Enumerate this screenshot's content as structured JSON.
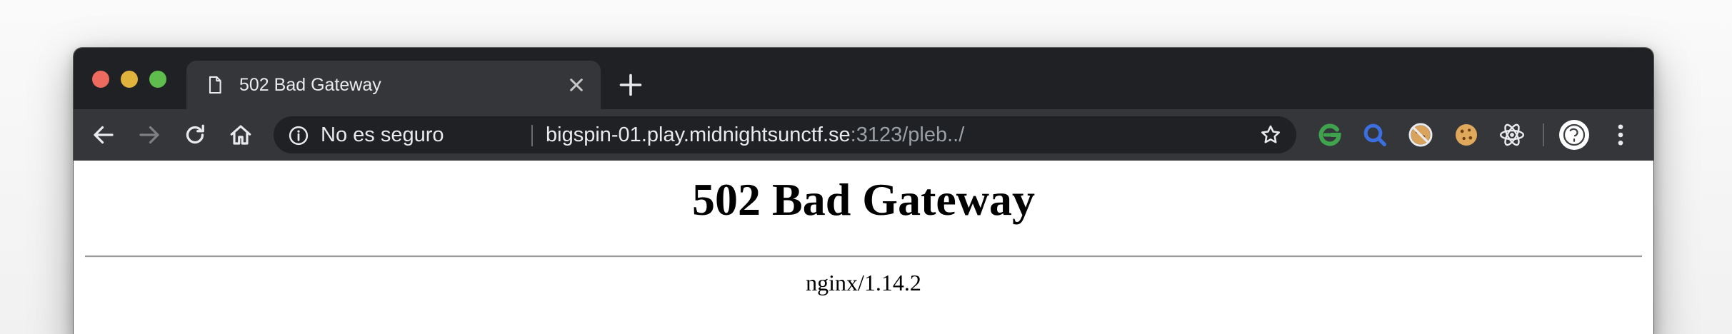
{
  "tab": {
    "title": "502 Bad Gateway",
    "favicon_icon": "document-icon",
    "close_icon": "close-icon"
  },
  "new_tab_icon": "plus-icon",
  "toolbar": {
    "back_icon": "arrow-left-icon",
    "forward_icon": "arrow-right-icon",
    "reload_icon": "reload-icon",
    "home_icon": "home-icon"
  },
  "omnibox": {
    "security_icon": "info-icon",
    "security_label": "No es seguro",
    "url_host": "bigspin-01.play.midnightsunctf.se",
    "url_rest": ":3123/pleb../",
    "bookmark_icon": "star-outline-icon"
  },
  "extensions": [
    {
      "icon": "grammarly-g-icon",
      "color": "#3fa34d"
    },
    {
      "icon": "magnifier-icon",
      "color": "#3b6fe0"
    },
    {
      "icon": "blocked-cookie-icon",
      "color": "#d9a35c"
    },
    {
      "icon": "cookie-icon",
      "color": "#e0a85a"
    },
    {
      "icon": "react-atom-icon",
      "color": "#e8eaed"
    }
  ],
  "profile_icon": "avatar-icon",
  "menu_icon": "vertical-dots-icon",
  "page": {
    "heading": "502 Bad Gateway",
    "server": "nginx/1.14.2"
  },
  "colors": {
    "titlebar": "#202124",
    "toolbar": "#35363a",
    "omnibox": "#202124"
  }
}
